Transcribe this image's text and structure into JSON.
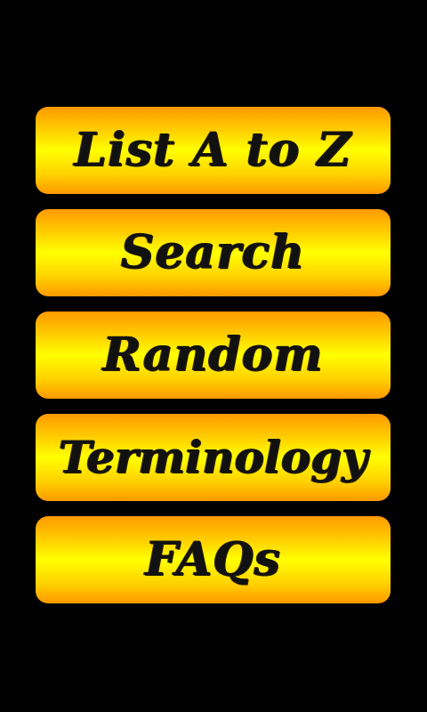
{
  "menu": {
    "items": [
      {
        "label": "List A to Z"
      },
      {
        "label": "Search"
      },
      {
        "label": "Random"
      },
      {
        "label": "Terminology"
      },
      {
        "label": "FAQs"
      }
    ]
  },
  "colors": {
    "background": "#000000",
    "button_gradient_edge": "#ff9a00",
    "button_gradient_center": "#ffff00",
    "label_text": "#111111"
  }
}
